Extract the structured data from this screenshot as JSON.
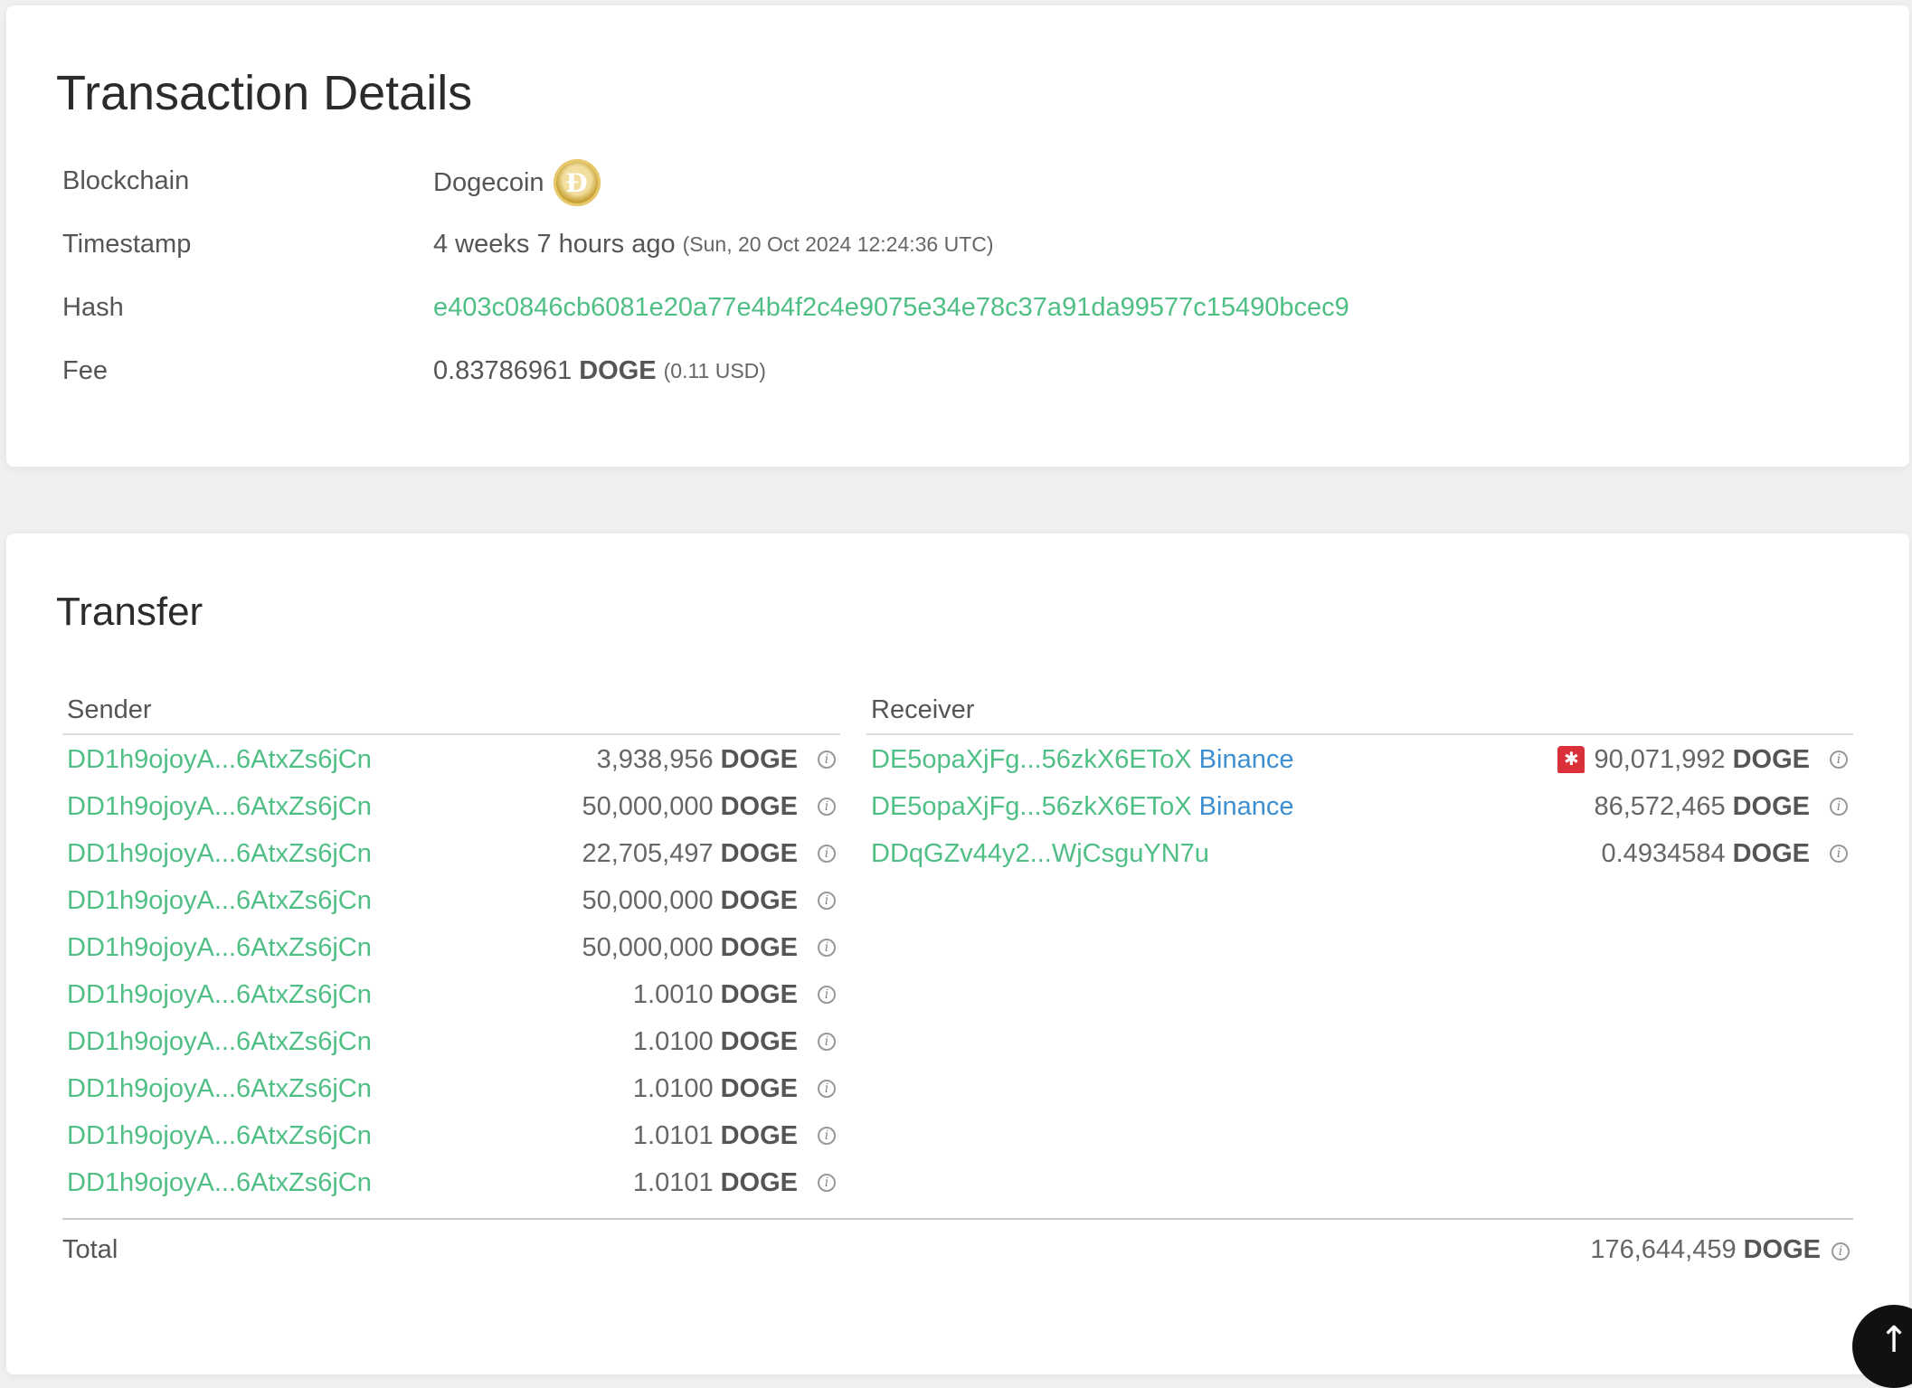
{
  "details": {
    "title": "Transaction Details",
    "blockchain_label": "Blockchain",
    "blockchain_value": "Dogecoin",
    "timestamp_label": "Timestamp",
    "timestamp_relative": "4 weeks 7 hours ago",
    "timestamp_absolute": "(Sun, 20 Oct 2024 12:24:36 UTC)",
    "hash_label": "Hash",
    "hash_value": "e403c0846cb6081e20a77e4b4f2c4e9075e34e78c37a91da99577c15490bcec9",
    "fee_label": "Fee",
    "fee_amount": "0.83786961",
    "fee_unit": "DOGE",
    "fee_usd": "(0.11 USD)"
  },
  "transfer": {
    "title": "Transfer",
    "sender_header": "Sender",
    "receiver_header": "Receiver",
    "senders": [
      {
        "address": "DD1h9ojoyA...6AtxZs6jCn",
        "amount": "3,938,956",
        "unit": "DOGE"
      },
      {
        "address": "DD1h9ojoyA...6AtxZs6jCn",
        "amount": "50,000,000",
        "unit": "DOGE"
      },
      {
        "address": "DD1h9ojoyA...6AtxZs6jCn",
        "amount": "22,705,497",
        "unit": "DOGE"
      },
      {
        "address": "DD1h9ojoyA...6AtxZs6jCn",
        "amount": "50,000,000",
        "unit": "DOGE"
      },
      {
        "address": "DD1h9ojoyA...6AtxZs6jCn",
        "amount": "50,000,000",
        "unit": "DOGE"
      },
      {
        "address": "DD1h9ojoyA...6AtxZs6jCn",
        "amount": "1.0010",
        "unit": "DOGE"
      },
      {
        "address": "DD1h9ojoyA...6AtxZs6jCn",
        "amount": "1.0100",
        "unit": "DOGE"
      },
      {
        "address": "DD1h9ojoyA...6AtxZs6jCn",
        "amount": "1.0100",
        "unit": "DOGE"
      },
      {
        "address": "DD1h9ojoyA...6AtxZs6jCn",
        "amount": "1.0101",
        "unit": "DOGE"
      },
      {
        "address": "DD1h9ojoyA...6AtxZs6jCn",
        "amount": "1.0101",
        "unit": "DOGE"
      }
    ],
    "receivers": [
      {
        "address": "DE5opaXjFg...56zkX6EToX",
        "tag": "Binance",
        "alert": true,
        "amount": "90,071,992",
        "unit": "DOGE"
      },
      {
        "address": "DE5opaXjFg...56zkX6EToX",
        "tag": "Binance",
        "alert": false,
        "amount": "86,572,465",
        "unit": "DOGE"
      },
      {
        "address": "DDqGZv44y2...WjCsguYN7u",
        "tag": "",
        "alert": false,
        "amount": "0.4934584",
        "unit": "DOGE"
      }
    ],
    "total_label": "Total",
    "total_amount": "176,644,459",
    "total_unit": "DOGE"
  },
  "icons": {
    "coin": "dogecoin-coin-icon",
    "info": "info-circle-icon",
    "alert": "siren-alert-icon",
    "scroll_top": "arrow-up-icon"
  },
  "colors": {
    "link_green": "#4fbf85",
    "tag_blue": "#3d8fd1",
    "alert_red": "#d9303a"
  }
}
